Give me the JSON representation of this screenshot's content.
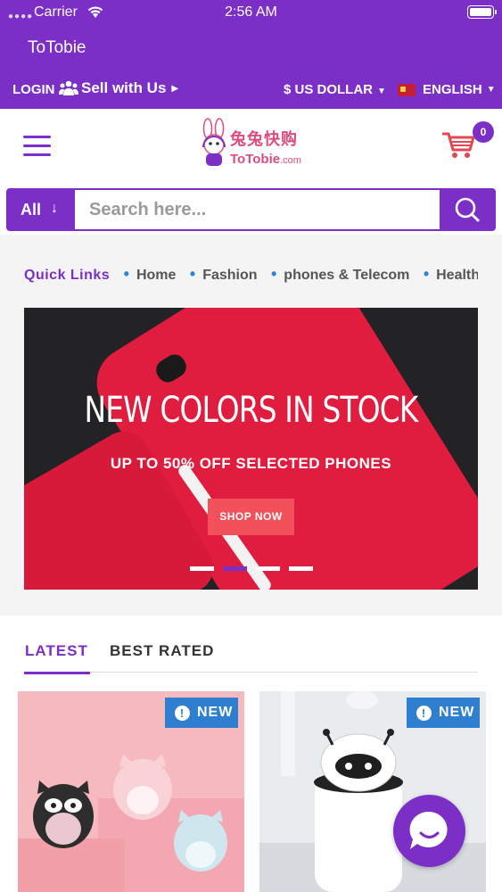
{
  "status_bar": {
    "carrier": "Carrier",
    "time": "2:56 AM"
  },
  "app": {
    "title": "ToTobie"
  },
  "utility_bar": {
    "login": "LOGIN",
    "sell": "Sell with Us",
    "currency": "$ US DOLLAR",
    "language": "ENGLISH"
  },
  "header": {
    "logo_cn": "兔兔快购",
    "logo_en": "ToTobie",
    "logo_domain": ".com",
    "cart_count": "0"
  },
  "search": {
    "category": "All",
    "placeholder": "Search here..."
  },
  "quick_links": {
    "title": "Quick Links",
    "items": [
      "Home",
      "Fashion",
      "phones & Telecom",
      "Health & Beauty"
    ]
  },
  "banner": {
    "title": "NEW COLORS IN STOCK",
    "subtitle": "UP TO 50% OFF SELECTED PHONES",
    "cta": "SHOP NOW",
    "slide_count": 4,
    "active_slide": 2
  },
  "tabs": [
    {
      "label": "LATEST",
      "active": true
    },
    {
      "label": "BEST RATED",
      "active": false
    }
  ],
  "products": [
    {
      "badge": "NEW"
    },
    {
      "badge": "NEW"
    }
  ],
  "colors": {
    "primary": "#7b2fc6",
    "badge": "#2f7fd1",
    "cta": "#f2505a",
    "logo": "#e04b7f"
  }
}
